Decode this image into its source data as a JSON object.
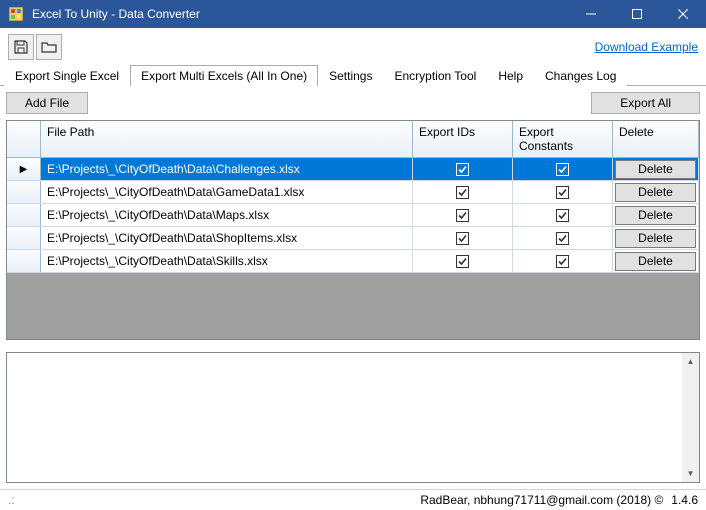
{
  "window": {
    "title": "Excel To Unity - Data Converter"
  },
  "toolbar": {
    "download_link": "Download Example"
  },
  "tabs": [
    {
      "label": "Export Single Excel"
    },
    {
      "label": "Export Multi Excels (All In One)"
    },
    {
      "label": "Settings"
    },
    {
      "label": "Encryption Tool"
    },
    {
      "label": "Help"
    },
    {
      "label": "Changes Log"
    }
  ],
  "active_tab": 1,
  "buttons": {
    "add_file": "Add File",
    "export_all": "Export All"
  },
  "grid": {
    "headers": {
      "path": "File Path",
      "ids": "Export IDs",
      "constants": "Export Constants",
      "delete": "Delete"
    },
    "delete_label": "Delete",
    "rows": [
      {
        "path": "E:\\Projects\\_\\CityOfDeath\\Data\\Challenges.xlsx",
        "ids": true,
        "constants": true,
        "selected": true
      },
      {
        "path": "E:\\Projects\\_\\CityOfDeath\\Data\\GameData1.xlsx",
        "ids": true,
        "constants": true,
        "selected": false
      },
      {
        "path": "E:\\Projects\\_\\CityOfDeath\\Data\\Maps.xlsx",
        "ids": true,
        "constants": true,
        "selected": false
      },
      {
        "path": "E:\\Projects\\_\\CityOfDeath\\Data\\ShopItems.xlsx",
        "ids": true,
        "constants": true,
        "selected": false
      },
      {
        "path": "E:\\Projects\\_\\CityOfDeath\\Data\\Skills.xlsx",
        "ids": true,
        "constants": true,
        "selected": false
      }
    ]
  },
  "status": {
    "credit": "RadBear, nbhung71711@gmail.com (2018) ©",
    "version": "1.4.6"
  }
}
